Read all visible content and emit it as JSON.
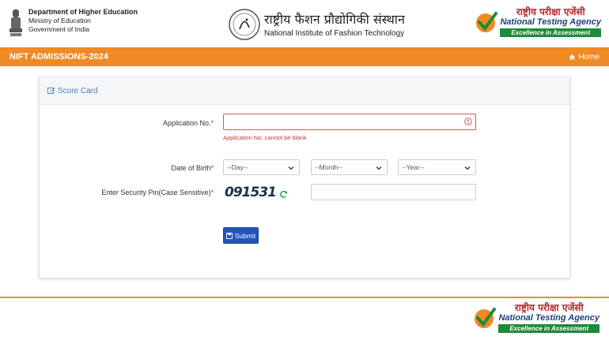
{
  "header": {
    "ministry": {
      "line1": "Department of Higher Education",
      "line2": "Ministry of Education",
      "line3": "Government of India"
    },
    "institute": {
      "hindi": "राष्ट्रीय फैशन प्रौद्योगिकी संस्थान",
      "english": "National Institute of Fashion Technology"
    },
    "nta": {
      "hindi": "राष्ट्रीय परीक्षा एजेंसी",
      "english": "National Testing Agency",
      "tagline": "Excellence in Assessment"
    }
  },
  "navbar": {
    "title": "NIFT ADMISSIONS-2024",
    "home": "Home"
  },
  "card": {
    "title": "Score Card",
    "application": {
      "label": "Application No.",
      "required": "*",
      "value": "",
      "error": "Application No. cannot be blank."
    },
    "dob": {
      "label": "Date of Birth",
      "required": "*",
      "day": "--Day--",
      "month": "--Month--",
      "year": "--Year--"
    },
    "security": {
      "label": "Enter Security Pin(Case Sensitive)",
      "required": "*",
      "captcha": "091531",
      "value": ""
    },
    "submit": "Submit"
  },
  "colors": {
    "accent_orange": "#f08a24",
    "link_blue": "#4a7bc3",
    "button_blue": "#2155b8",
    "error_red": "#d9534f",
    "nta_green": "#1f8a3a"
  }
}
